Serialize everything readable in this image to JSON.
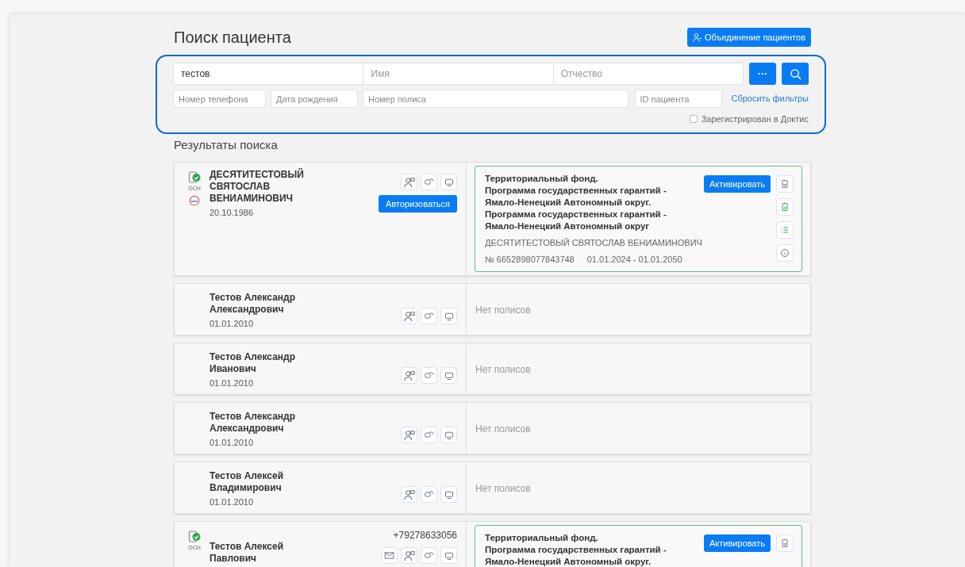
{
  "title": "Поиск пациента",
  "merge_button": "Объединение пациентов",
  "search": {
    "fields_row1": [
      {
        "value": "тестов"
      },
      {
        "placeholder": "Имя"
      },
      {
        "placeholder": "Отчество"
      }
    ],
    "more_button": "···",
    "fields_row2": [
      {
        "placeholder": "Номер телефона"
      },
      {
        "placeholder": "Дата рождения"
      },
      {
        "placeholder": "Номер полиса"
      },
      {
        "placeholder": "ID пациента"
      }
    ],
    "reset_link": "Сбросить фильтры",
    "registered": {
      "label": "Зарегистрирован в Доктис",
      "checked": false
    }
  },
  "results_title": "Результаты поиска",
  "patients": [
    {
      "name": "ДЕСЯТИТЕСТОВЫЙ СВЯТОСЛАВ ВЕНИАМИНОВИЧ",
      "date": "20.10.1986",
      "badge": "ОСН",
      "verified": true,
      "mail": false,
      "authorize": "Авторизоваться",
      "policies": [
        {
          "title_lines": [
            "Территориальный фонд.",
            "Программа государственных гарантий -",
            "Ямало-Ненецкий Автономный округ.",
            "Программа государственных гарантий -",
            "Ямало-Ненецкий Автономный округ"
          ],
          "holder": "ДЕСЯТИТЕСТОВЫЙ СВЯТОСЛАВ ВЕНИАМИНОВИЧ",
          "number": "№ 6652898077843748",
          "period": "01.01.2024 - 01.01.2050",
          "activate": "Активировать"
        }
      ]
    },
    {
      "name": "Тестов Александр Александрович",
      "date": "01.01.2010",
      "verified": false,
      "mail": false,
      "no_policies": "Нет полисов"
    },
    {
      "name": "Тестов Александр Иванович",
      "date": "01.01.2010",
      "verified": false,
      "mail": false,
      "no_policies": "Нет полисов"
    },
    {
      "name": "Тестов Александр Александрович",
      "date": "01.01.2010",
      "verified": false,
      "mail": false,
      "no_policies": "Нет полисов"
    },
    {
      "name": "Тестов Алексей Владимирович",
      "date": "01.01.2010",
      "verified": false,
      "mail": false,
      "no_policies": "Нет полисов"
    },
    {
      "name": "Тестов Алексей Павлович",
      "badge": "ОСН",
      "verified": true,
      "phone": "+79278633056",
      "mail": true,
      "policies": [
        {
          "title_lines": [
            "Территориальный фонд.",
            "Программа государственных гарантий -",
            "Ямало-Ненецкий Автономный округ."
          ],
          "activate": "Активировать"
        }
      ]
    }
  ]
}
